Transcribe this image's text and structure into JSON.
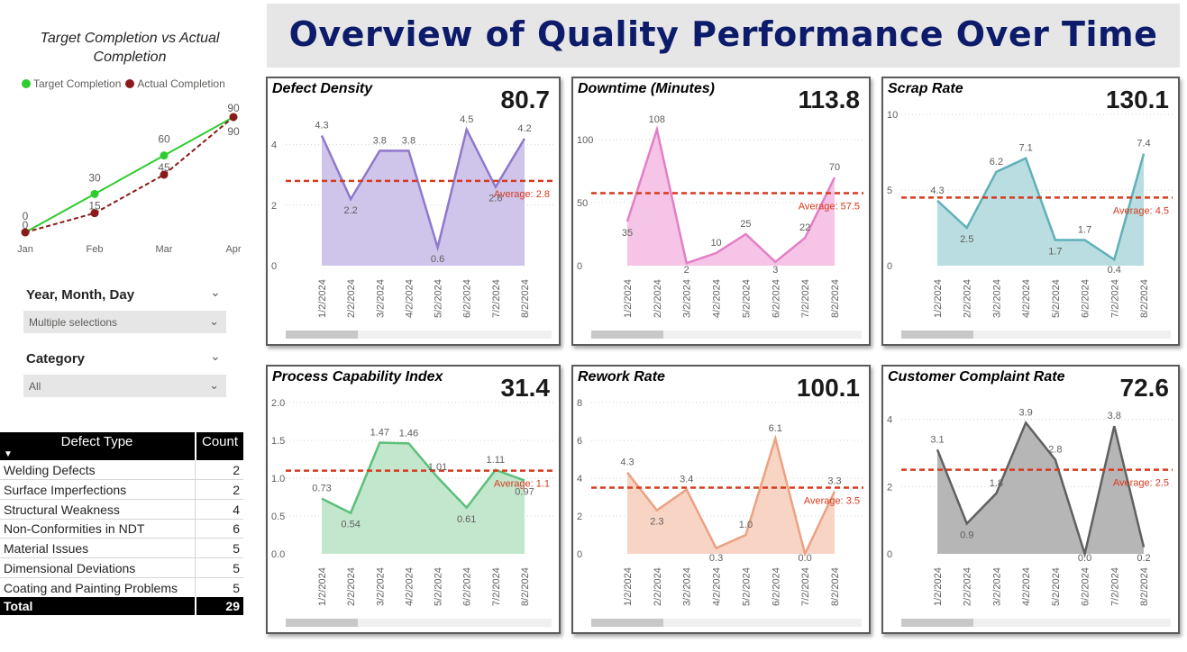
{
  "header": {
    "title": "Overview of Quality Performance Over Time"
  },
  "left_chart": {
    "title": "Target Completion vs Actual Completion",
    "legend": [
      {
        "label": "Target Completion",
        "color": "#2ecc2e"
      },
      {
        "label": "Actual Completion",
        "color": "#8b1a1a"
      }
    ],
    "chart_data": {
      "type": "line",
      "title": "Target Completion vs Actual Completion",
      "categories": [
        "Jan",
        "Feb",
        "Mar",
        "Apr"
      ],
      "series": [
        {
          "name": "Target Completion",
          "values": [
            0,
            30,
            60,
            90
          ],
          "color": "#2ecc2e"
        },
        {
          "name": "Actual Completion",
          "values": [
            0,
            15,
            45,
            90
          ],
          "color": "#8b1a1a"
        }
      ]
    }
  },
  "slicers": [
    {
      "title": "Year, Month, Day",
      "value": "Multiple selections"
    },
    {
      "title": "Category",
      "value": "All"
    }
  ],
  "defect_table": {
    "columns": [
      "Defect Type",
      "Count"
    ],
    "rows": [
      [
        "Welding Defects",
        "2"
      ],
      [
        "Surface Imperfections",
        "2"
      ],
      [
        "Structural Weakness",
        "4"
      ],
      [
        "Non-Conformities in NDT",
        "6"
      ],
      [
        "Material Issues",
        "5"
      ],
      [
        "Dimensional Deviations",
        "5"
      ],
      [
        "Coating and Painting Problems",
        "5"
      ]
    ],
    "total_label": "Total",
    "total_value": "29"
  },
  "cards": [
    {
      "title": "Defect Density",
      "kpi": "80.7",
      "color": "#8f78cc",
      "fill": "#cfc4ea",
      "chart_data": {
        "type": "area",
        "x": [
          "1/2/2024",
          "2/2/2024",
          "3/2/2024",
          "4/2/2024",
          "5/2/2024",
          "6/2/2024",
          "7/2/2024",
          "8/2/2024"
        ],
        "values": [
          4.3,
          2.2,
          3.8,
          3.8,
          0.6,
          4.5,
          2.6,
          4.2
        ],
        "labels": [
          "4.3",
          "2.2",
          "3.8",
          "3.8",
          "0.6",
          "4.5",
          "2.6",
          "4.2"
        ],
        "ylim": [
          0,
          5
        ],
        "yticks": [
          0,
          2,
          4
        ],
        "ytick_labels": [
          "0",
          "2",
          "4"
        ],
        "average": 2.8,
        "average_label": "Average: 2.8"
      }
    },
    {
      "title": "Downtime (Minutes)",
      "kpi": "113.8",
      "color": "#e37fc6",
      "fill": "#f5c4e6",
      "chart_data": {
        "type": "area",
        "x": [
          "1/2/2024",
          "2/2/2024",
          "3/2/2024",
          "4/2/2024",
          "5/2/2024",
          "6/2/2024",
          "7/2/2024",
          "8/2/2024"
        ],
        "values": [
          35,
          108,
          2,
          10,
          25,
          3,
          22,
          70
        ],
        "labels": [
          "35",
          "108",
          "2",
          "10",
          "25",
          "3",
          "22",
          "70"
        ],
        "ylim": [
          0,
          120
        ],
        "yticks": [
          0,
          50,
          100
        ],
        "ytick_labels": [
          "0",
          "50",
          "100"
        ],
        "average": 57.5,
        "average_label": "Average: 57.5"
      }
    },
    {
      "title": "Scrap Rate",
      "kpi": "130.1",
      "color": "#5fb0b8",
      "fill": "#b9dde0",
      "chart_data": {
        "type": "area",
        "x": [
          "1/2/2024",
          "2/2/2024",
          "3/2/2024",
          "4/2/2024",
          "5/2/2024",
          "6/2/2024",
          "7/2/2024",
          "8/2/2024"
        ],
        "values": [
          4.3,
          2.5,
          6.2,
          7.1,
          1.7,
          1.7,
          0.4,
          7.4
        ],
        "labels": [
          "4.3",
          "2.5",
          "6.2",
          "7.1",
          "1.7",
          "1.7",
          "0.4",
          "7.4"
        ],
        "ylim": [
          0,
          10
        ],
        "yticks": [
          0,
          5,
          10
        ],
        "ytick_labels": [
          "0",
          "5",
          "10"
        ],
        "average": 4.5,
        "average_label": "Average: 4.5"
      }
    },
    {
      "title": "Process Capability Index",
      "kpi": "31.4",
      "color": "#5cbf7a",
      "fill": "#c2e7cd",
      "chart_data": {
        "type": "area",
        "x": [
          "1/2/2024",
          "2/2/2024",
          "3/2/2024",
          "4/2/2024",
          "5/2/2024",
          "6/2/2024",
          "7/2/2024",
          "8/2/2024"
        ],
        "values": [
          0.73,
          0.54,
          1.47,
          1.46,
          1.01,
          0.61,
          1.11,
          0.97
        ],
        "labels": [
          "0.73",
          "0.54",
          "1.47",
          "1.46",
          "1.01",
          "0.61",
          "1.11",
          "0.97"
        ],
        "ylim": [
          0,
          2
        ],
        "yticks": [
          0,
          0.5,
          1.0,
          1.5,
          2.0
        ],
        "ytick_labels": [
          "0.0",
          "0.5",
          "1.0",
          "1.5",
          "2.0"
        ],
        "average": 1.1,
        "average_label": "Average: 1.1"
      }
    },
    {
      "title": "Rework Rate",
      "kpi": "100.1",
      "color": "#eba283",
      "fill": "#f7d4c4",
      "chart_data": {
        "type": "area",
        "x": [
          "1/2/2024",
          "2/2/2024",
          "3/2/2024",
          "4/2/2024",
          "5/2/2024",
          "6/2/2024",
          "7/2/2024",
          "8/2/2024"
        ],
        "values": [
          4.3,
          2.3,
          3.4,
          0.3,
          1.0,
          6.1,
          0.0,
          3.3
        ],
        "labels": [
          "4.3",
          "2.3",
          "3.4",
          "0.3",
          "1.0",
          "6.1",
          "0.0",
          "3.3"
        ],
        "ylim": [
          0,
          8
        ],
        "yticks": [
          0,
          2,
          4,
          6,
          8
        ],
        "ytick_labels": [
          "0",
          "2",
          "4",
          "6",
          "8"
        ],
        "average": 3.5,
        "average_label": "Average: 3.5"
      }
    },
    {
      "title": "Customer Complaint Rate",
      "kpi": "72.6",
      "color": "#606060",
      "fill": "#b6b6b6",
      "chart_data": {
        "type": "area",
        "x": [
          "1/2/2024",
          "2/2/2024",
          "3/2/2024",
          "4/2/2024",
          "5/2/2024",
          "6/2/2024",
          "7/2/2024",
          "8/2/2024"
        ],
        "values": [
          3.1,
          0.9,
          1.8,
          3.9,
          2.8,
          0.0,
          3.8,
          0.2
        ],
        "labels": [
          "3.1",
          "0.9",
          "1.8",
          "3.9",
          "2.8",
          "0.0",
          "3.8",
          "0.2"
        ],
        "ylim": [
          0,
          4.5
        ],
        "yticks": [
          0,
          2,
          4
        ],
        "ytick_labels": [
          "0",
          "2",
          "4"
        ],
        "average": 2.5,
        "average_label": "Average: 2.5"
      }
    }
  ]
}
